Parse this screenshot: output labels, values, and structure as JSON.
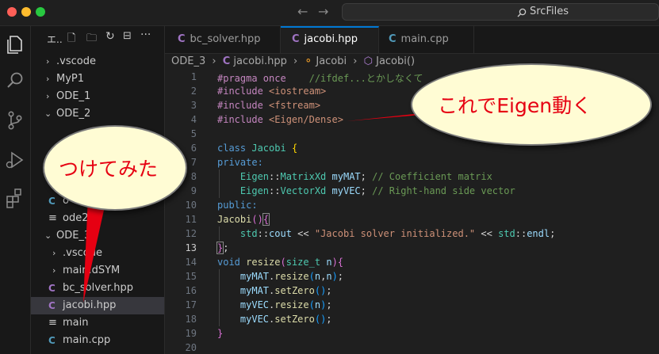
{
  "titlebar": {
    "search": "SrcFiles",
    "back_icon": "arrow-left-icon",
    "forward_icon": "arrow-right-icon"
  },
  "sidebar": {
    "header": "エ..",
    "items": [
      {
        "label": ".vscode",
        "type": "folder-closed"
      },
      {
        "label": "MyP1",
        "type": "folder-closed"
      },
      {
        "label": "ODE_1",
        "type": "folder-closed"
      },
      {
        "label": "ODE_2",
        "type": "folder-open"
      },
      {
        "label": "o",
        "type": "cpp"
      },
      {
        "label": "ode2.c",
        "type": "file"
      },
      {
        "label": "ODE_3",
        "type": "folder-open"
      },
      {
        "label": ".vscode",
        "type": "folder-closed"
      },
      {
        "label": "main.dSYM",
        "type": "folder-closed"
      },
      {
        "label": "bc_solver.hpp",
        "type": "cpp"
      },
      {
        "label": "jacobi.hpp",
        "type": "cpp"
      },
      {
        "label": "main",
        "type": "file"
      },
      {
        "label": "main.cpp",
        "type": "cpp-blue"
      }
    ]
  },
  "tabs": [
    {
      "label": "bc_solver.hpp",
      "active": false
    },
    {
      "label": "jacobi.hpp",
      "active": true
    },
    {
      "label": "main.cpp",
      "active": false
    }
  ],
  "breadcrumb": {
    "folder": "ODE_3",
    "file": "jacobi.hpp",
    "class": "Jacobi",
    "method": "Jacobi()"
  },
  "editor": {
    "line_numbers": [
      "1",
      "2",
      "3",
      "4",
      "5",
      "6",
      "7",
      "8",
      "9",
      "10",
      "11",
      "12",
      "13",
      "14",
      "15",
      "16",
      "17",
      "18",
      "19",
      "20"
    ],
    "current_line": "13",
    "lines": [
      "#pragma once    //ifdef...とかしなくて",
      "#include <iostream>",
      "#include <fstream>",
      "#include <Eigen/Dense>",
      "",
      "class Jacobi {",
      "private:",
      "    Eigen::MatrixXd myMAT; // Coefficient matrix",
      "    Eigen::VectorXd myVEC; // Right-hand side vector",
      "public:",
      "Jacobi(){",
      "    std::cout << \"Jacobi solver initialized.\" << std::endl;",
      "};",
      "void resize(size_t n){",
      "    myMAT.resize(n,n);",
      "    myMAT.setZero();",
      "    myVEC.resize(n);",
      "    myVEC.setZero();",
      "}",
      ""
    ]
  },
  "callouts": {
    "eigen": "これでEigen動く",
    "tried": "つけてみた"
  },
  "colors": {
    "callout_fill": "#fffcd4",
    "callout_text": "#e60012",
    "pointer": "#e60012"
  }
}
